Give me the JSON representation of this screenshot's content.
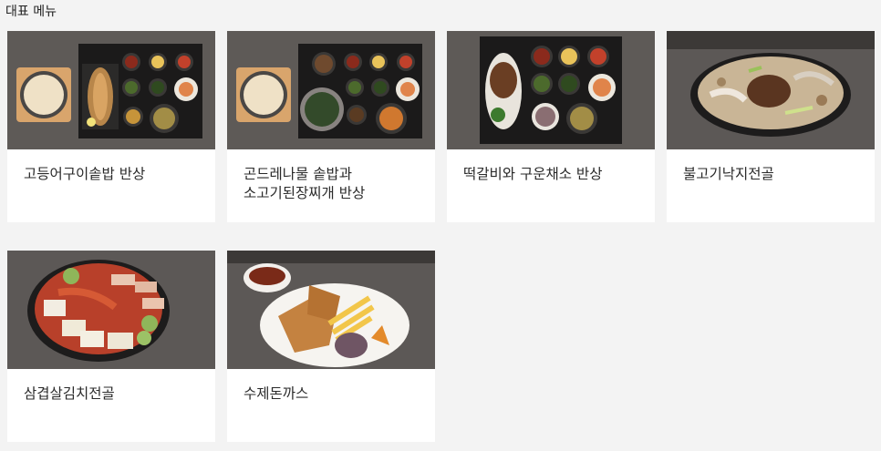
{
  "section": {
    "title": "대표 메뉴"
  },
  "menu": [
    {
      "name": "고등어구이솥밥 반상",
      "image": "grilled-mackerel-set-photo"
    },
    {
      "name": "곤드레나물 솥밥과 소고기된장찌개 반상",
      "image": "gondeure-rice-set-photo"
    },
    {
      "name": "떡갈비와 구운채소 반상",
      "image": "tteokgalbi-set-photo"
    },
    {
      "name": "불고기낙지전골",
      "image": "bulgogi-octopus-hotpot-photo"
    },
    {
      "name": "삼겹살김치전골",
      "image": "pork-kimchi-hotpot-photo"
    },
    {
      "name": "수제돈까스",
      "image": "handmade-tonkatsu-photo"
    }
  ]
}
